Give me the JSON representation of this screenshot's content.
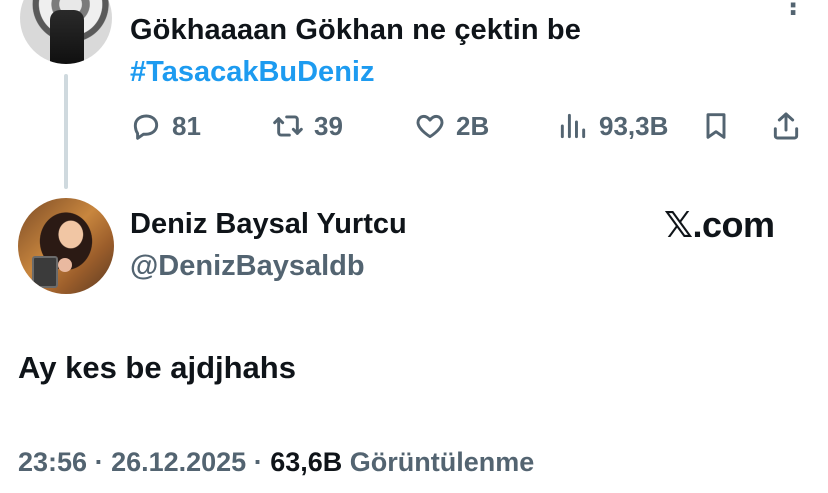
{
  "parent_tweet": {
    "text": "Gökhaaaan Gökhan ne çektin be",
    "hashtag": "#TasacakBuDeniz",
    "actions": {
      "replies": "81",
      "retweets": "39",
      "likes": "2B",
      "views": "93,3B"
    }
  },
  "main_tweet": {
    "display_name": "Deniz Baysal Yurtcu",
    "handle": "@DenizBaysaldb",
    "brand": "𝕏.com",
    "text": "Ay kes be ajdjhahs",
    "time": "23:56",
    "date": "26.12.2025",
    "separator": " · ",
    "views_count": "63,6B",
    "views_label": "Görüntülenme"
  },
  "colors": {
    "text": "#0f1419",
    "secondary": "#536471",
    "link": "#1d9bf0",
    "thread_line": "#cfd9de"
  },
  "icons": [
    "reply-icon",
    "retweet-icon",
    "like-icon",
    "views-icon",
    "bookmark-icon",
    "share-icon"
  ]
}
